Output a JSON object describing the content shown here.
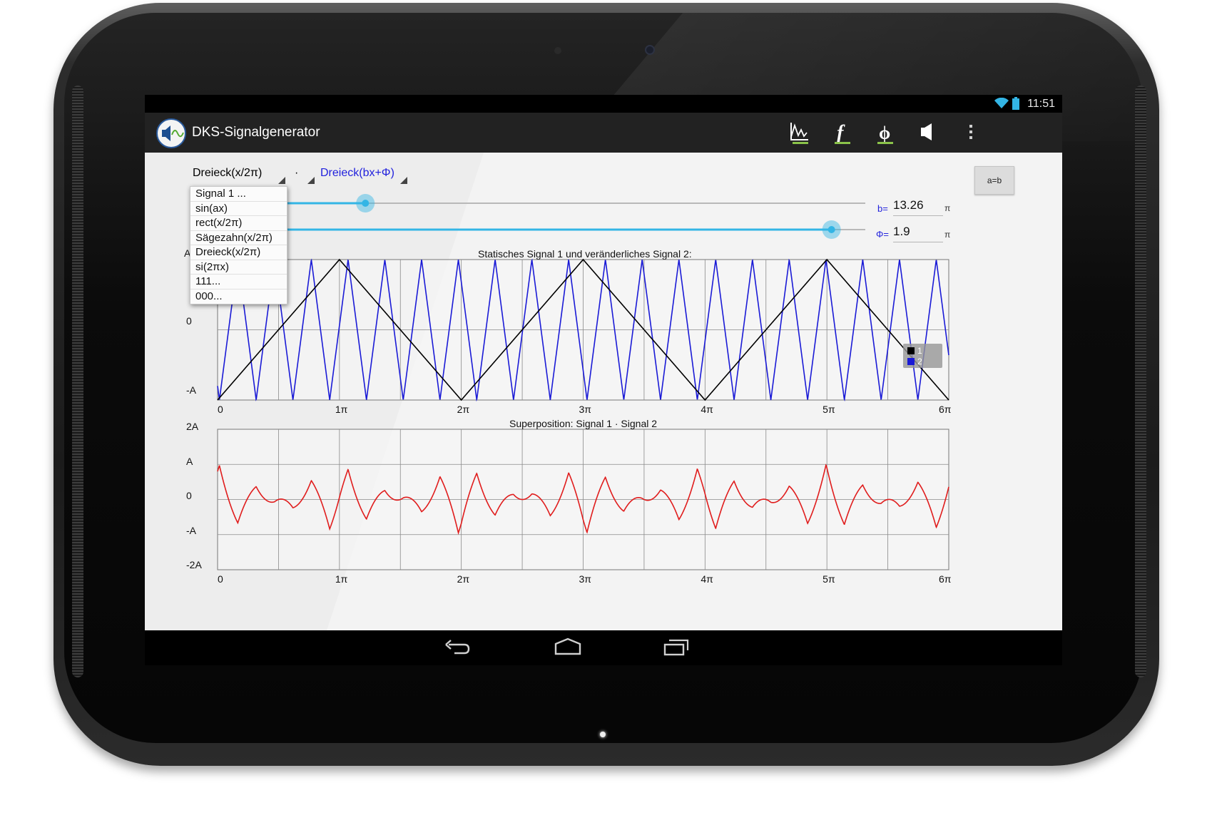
{
  "status": {
    "time": "11:51"
  },
  "app": {
    "title": "DKS-Signalgenerator"
  },
  "actions": [
    {
      "name": "signal-graph-icon"
    },
    {
      "name": "function-icon"
    },
    {
      "name": "phase-icon"
    },
    {
      "name": "speaker-icon"
    },
    {
      "name": "overflow-menu-icon"
    }
  ],
  "controls": {
    "signal1_selected": "Dreieck(x/2π)",
    "operator": "·",
    "signal2_selected": "Dreieck(bx+Φ)",
    "ab_button": "a=b",
    "b_label": "b=",
    "b_value": "13.26",
    "b_unit": "π",
    "phi_label": "Φ=",
    "phi_value": "1.9",
    "phi_unit": "π",
    "slider_b_fraction": 0.26,
    "slider_phi_fraction": 0.95
  },
  "dropdown": {
    "items": [
      "Signal 1 ...",
      "sin(ax)",
      "rect(x/2π)",
      "Sägezahn(x/2π)",
      "Dreieck(x/2π)",
      "si(2πx)",
      "111...",
      "000..."
    ]
  },
  "chart1": {
    "title": "Statisches Signal 1 und veränderliches Signal 2:",
    "ylabels": [
      "A",
      "0",
      "-A"
    ],
    "xlabels": [
      "0",
      "1π",
      "2π",
      "3π",
      "4π",
      "5π",
      "6π"
    ],
    "legend": [
      "1",
      "2"
    ]
  },
  "chart2": {
    "title": "Superposition: Signal 1 · Signal 2",
    "ylabels": [
      "2A",
      "A",
      "0",
      "-A",
      "-2A"
    ],
    "xlabels": [
      "0",
      "1π",
      "2π",
      "3π",
      "4π",
      "5π",
      "6π"
    ]
  },
  "chart_data": [
    {
      "type": "line",
      "title": "Statisches Signal 1 und veränderliches Signal 2:",
      "x_range_pi": [
        0,
        6
      ],
      "ylim": [
        -1,
        1
      ],
      "series": [
        {
          "name": "1",
          "color": "#000000",
          "function": "triangle",
          "period_pi": 2,
          "amplitude": 1
        },
        {
          "name": "2",
          "color": "#1a1ad6",
          "function": "triangle",
          "b": 13.26,
          "phi_pi": 1.9,
          "amplitude": 1
        }
      ]
    },
    {
      "type": "line",
      "title": "Superposition: Signal 1 · Signal 2",
      "x_range_pi": [
        0,
        6
      ],
      "ylim": [
        -2,
        2
      ],
      "series": [
        {
          "color": "#e01c1c",
          "function": "product"
        }
      ]
    }
  ],
  "navbar": [
    {
      "name": "back-icon"
    },
    {
      "name": "home-icon"
    },
    {
      "name": "recents-icon"
    }
  ]
}
